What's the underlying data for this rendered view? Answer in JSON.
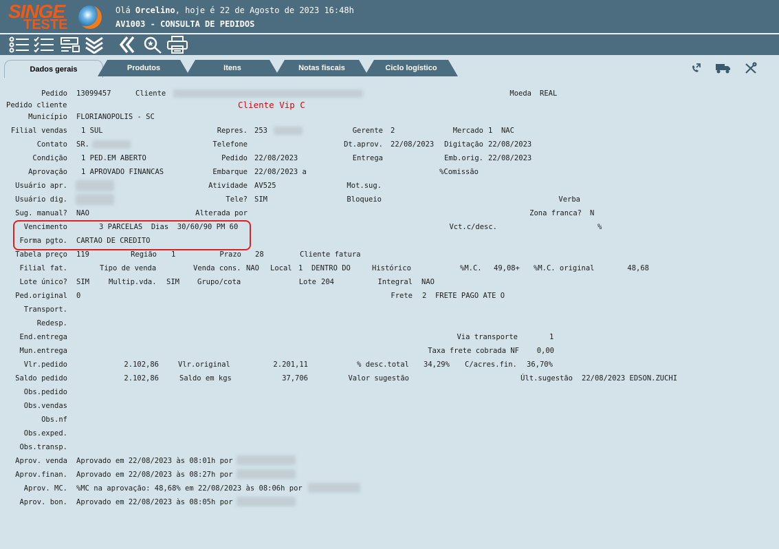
{
  "header": {
    "logo_top": "SINGE",
    "logo_bottom": "TESTE",
    "greeting_pre": "Olá ",
    "user": "Orcelino",
    "greeting_post": ", hoje é 22 de Agosto de 2023 16:48h",
    "screen_title": "AV1003 - CONSULTA DE PEDIDOS"
  },
  "tabs": [
    "Dados gerais",
    "Produtos",
    "Itens",
    "Notas fiscais",
    "Ciclo logístico"
  ],
  "colors": {
    "header_bg": "#4c6c80",
    "content_bg": "#d3e3e9",
    "logo": "#f05a14",
    "highlight": "#e02020",
    "vip": "#e0000a"
  },
  "icons": [
    "list-icon",
    "checklist-icon",
    "form-icon",
    "double-chevron-down-icon",
    "double-chevron-left-icon",
    "search-icon",
    "printer-icon",
    "phone-icon",
    "truck-icon",
    "tools-icon"
  ],
  "fields": {
    "pedido_l": "Pedido",
    "pedido": "13099457",
    "cliente_l": "Cliente",
    "moeda_l": "Moeda",
    "moeda": "REAL",
    "pedcli_l": "Pedido cliente",
    "vip": "Cliente Vip C",
    "municipio_l": "Município",
    "municipio": "FLORIANOPOLIS - SC",
    "filial_l": "Filial vendas",
    "filial": "1 SUL",
    "repres_l": "Repres.",
    "repres": "253",
    "gerente_l": "Gerente",
    "gerente": "2",
    "mercado_l": "Mercado",
    "mercado": "1  NAC",
    "contato_l": "Contato",
    "contato": "SR.",
    "telefone_l": "Telefone",
    "dtaprov_l": "Dt.aprov.",
    "dtaprov": "22/08/2023",
    "digitacao_l": "Digitação",
    "digitacao": "22/08/2023",
    "condicao_l": "Condição",
    "condicao": "1 PED.EM ABERTO",
    "pedido2_l": "Pedido",
    "pedido2": "22/08/2023",
    "entrega_l": "Entrega",
    "emborig_l": "Emb.orig.",
    "emborig": "22/08/2023",
    "aprovacao_l": "Aprovação",
    "aprovacao": "1 APROVADO FINANCAS",
    "embarque_l": "Embarque",
    "embarque": "22/08/2023 a",
    "comissao_l": "%Comissão",
    "usuapr_l": "Usuário apr.",
    "atividade_l": "Atividade",
    "atividade": "AV525",
    "motsug_l": "Mot.sug.",
    "usudig_l": "Usuário dig.",
    "tele_l": "Tele?",
    "tele": "SIM",
    "bloqueio_l": "Bloqueio",
    "verba_l": "Verba",
    "sugman_l": "Sug. manual?",
    "sugman": "NAO",
    "alterada_l": "Alterada por",
    "zona_l": "Zona franca?",
    "zona": "N",
    "venc_l": "Vencimento",
    "venc": "3 PARCELAS  Dias  30/60/90 PM 60",
    "vctdesc_l": "Vct.c/desc.",
    "pct": "%",
    "forma_l": "Forma pgto.",
    "forma": "CARTAO DE CREDITO",
    "tabela_l": "Tabela preço",
    "tabela": "119",
    "regiao_l": "Região",
    "regiao": "1",
    "prazo_l": "Prazo",
    "prazo": "28",
    "clifat_l": "Cliente fatura",
    "filfat_l": "Filial fat.",
    "tipovenda_l": "Tipo de venda",
    "vendacons_l": "Venda cons.",
    "vendacons": "NAO",
    "local_l": "Local",
    "local": "1  DENTRO DO",
    "historico_l": "Histórico",
    "mc_l": "%M.C.",
    "mc": "49,08+",
    "mcorig_l": "%M.C. original",
    "mcorig": "48,68",
    "loteunico_l": "Lote único?",
    "loteunico": "SIM",
    "multip_l": "Multip.vda.",
    "multip": "SIM",
    "grupo_l": "Grupo/cota",
    "lote_l": "Lote",
    "lote": "204",
    "integral_l": "Integral",
    "integral": "NAO",
    "pedorig_l": "Ped.original",
    "pedorig": "0",
    "frete_l": "Frete",
    "frete": "2  FRETE PAGO ATE O",
    "transport_l": "Transport.",
    "redesp_l": "Redesp.",
    "endent_l": "End.entrega",
    "via_l": "Via transporte",
    "via": "1",
    "munent_l": "Mun.entrega",
    "taxa_l": "Taxa frete cobrada NF",
    "taxa": "0,00",
    "vlrped_l": "Vlr.pedido",
    "vlrped": "2.102,86",
    "vlrorig_l": "Vlr.original",
    "vlrorig": "2.201,11",
    "desctot_l": "% desc.total",
    "desctot": "34,29%",
    "acres_l": "C/acres.fin.",
    "acres": "36,70%",
    "saldo_l": "Saldo pedido",
    "saldo": "2.102,86",
    "saldokg_l": "Saldo em kgs",
    "saldokg": "37,706",
    "valsug_l": "Valor sugestão",
    "ultsug_l": "Últ.sugestão",
    "ultsug": "22/08/2023 EDSON.ZUCHI",
    "obsped_l": "Obs.pedido",
    "obsvend_l": "Obs.vendas",
    "obsnf_l": "Obs.nf",
    "obsexp_l": "Obs.exped.",
    "obstransp_l": "Obs.transp.",
    "aprvenda_l": "Aprov. venda",
    "aprvenda": "Aprovado em 22/08/2023 às 08:01h por",
    "aprfin_l": "Aprov.finan.",
    "aprfin": "Aprovado em 22/08/2023 às 08:27h por",
    "aprmc_l": "Aprov. MC.",
    "aprmc": "%MC na aprovação: 48,68% em 22/08/2023 às 08:06h por",
    "aprbon_l": "Aprov. bon.",
    "aprbon": "Aprovado em 22/08/2023 às 08:05h por"
  }
}
